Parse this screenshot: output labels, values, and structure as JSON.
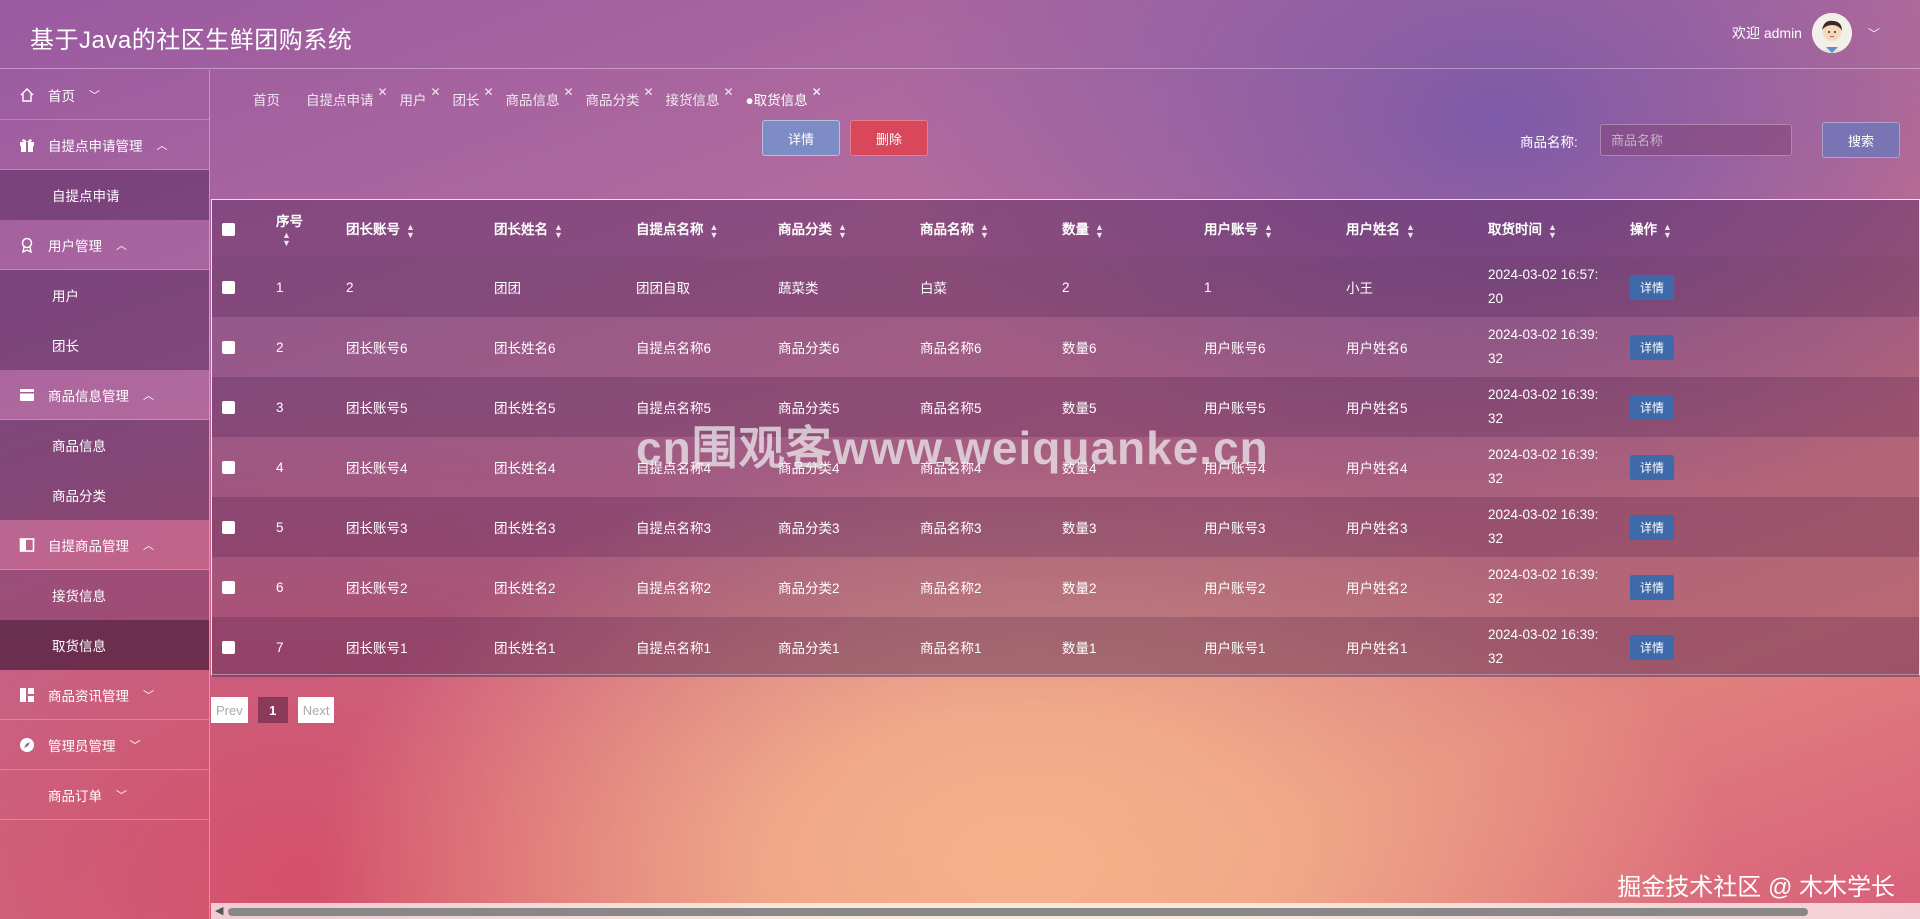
{
  "header": {
    "title": "基于Java的社区生鲜团购系统",
    "welcome": "欢迎 admin",
    "caret_icon": "chevron-down-icon"
  },
  "sidebar": {
    "groups": [
      {
        "label": "首页",
        "icon": "home-icon",
        "arrow": "﹀"
      },
      {
        "label": "自提点申请管理",
        "icon": "gift-icon",
        "arrow": "︿",
        "items": [
          "自提点申请"
        ]
      },
      {
        "label": "用户管理",
        "icon": "award-icon",
        "arrow": "︿",
        "items": [
          "用户",
          "团长"
        ]
      },
      {
        "label": "商品信息管理",
        "icon": "card-icon",
        "arrow": "︿",
        "items": [
          "商品信息",
          "商品分类"
        ]
      },
      {
        "label": "自提商品管理",
        "icon": "panel-icon",
        "arrow": "︿",
        "items": [
          "接货信息",
          "取货信息"
        ]
      },
      {
        "label": "商品资讯管理",
        "icon": "dashboard-icon",
        "arrow": "﹀"
      },
      {
        "label": "管理员管理",
        "icon": "compass-icon",
        "arrow": "﹀"
      },
      {
        "label": "商品订单",
        "icon": "",
        "arrow": "﹀"
      }
    ]
  },
  "tabs": [
    {
      "label": "首页",
      "closable": false
    },
    {
      "label": "自提点申请",
      "closable": true
    },
    {
      "label": "用户",
      "closable": true
    },
    {
      "label": "团长",
      "closable": true
    },
    {
      "label": "商品信息",
      "closable": true
    },
    {
      "label": "商品分类",
      "closable": true
    },
    {
      "label": "接货信息",
      "closable": true
    },
    {
      "label": "●取货信息",
      "closable": true,
      "active": true
    }
  ],
  "toolbar": {
    "detail_label": "详情",
    "delete_label": "删除",
    "search_label": "商品名称:",
    "search_placeholder": "商品名称",
    "search_button": "搜索"
  },
  "table": {
    "columns": [
      "序号",
      "团长账号",
      "团长姓名",
      "自提点名称",
      "商品分类",
      "商品名称",
      "数量",
      "用户账号",
      "用户姓名",
      "取货时间",
      "操作"
    ],
    "rows": [
      [
        "1",
        "2",
        "团团",
        "团团自取",
        "蔬菜类",
        "白菜",
        "2",
        "1",
        "小王",
        "2024-03-02 16:57:",
        "20"
      ],
      [
        "2",
        "团长账号6",
        "团长姓名6",
        "自提点名称6",
        "商品分类6",
        "商品名称6",
        "数量6",
        "用户账号6",
        "用户姓名6",
        "2024-03-02 16:39:",
        "32"
      ],
      [
        "3",
        "团长账号5",
        "团长姓名5",
        "自提点名称5",
        "商品分类5",
        "商品名称5",
        "数量5",
        "用户账号5",
        "用户姓名5",
        "2024-03-02 16:39:",
        "32"
      ],
      [
        "4",
        "团长账号4",
        "团长姓名4",
        "自提点名称4",
        "商品分类4",
        "商品名称4",
        "数量4",
        "用户账号4",
        "用户姓名4",
        "2024-03-02 16:39:",
        "32"
      ],
      [
        "5",
        "团长账号3",
        "团长姓名3",
        "自提点名称3",
        "商品分类3",
        "商品名称3",
        "数量3",
        "用户账号3",
        "用户姓名3",
        "2024-03-02 16:39:",
        "32"
      ],
      [
        "6",
        "团长账号2",
        "团长姓名2",
        "自提点名称2",
        "商品分类2",
        "商品名称2",
        "数量2",
        "用户账号2",
        "用户姓名2",
        "2024-03-02 16:39:",
        "32"
      ],
      [
        "7",
        "团长账号1",
        "团长姓名1",
        "自提点名称1",
        "商品分类1",
        "商品名称1",
        "数量1",
        "用户账号1",
        "用户姓名1",
        "2024-03-02 16:39:",
        "32"
      ]
    ],
    "row_action": "详情"
  },
  "pagination": {
    "prev": "Prev",
    "current": "1",
    "next": "Next"
  },
  "watermarks": {
    "center": "cn围观客www.weiquanke.cn",
    "corner": "掘金技术社区 @ 木木学长"
  }
}
